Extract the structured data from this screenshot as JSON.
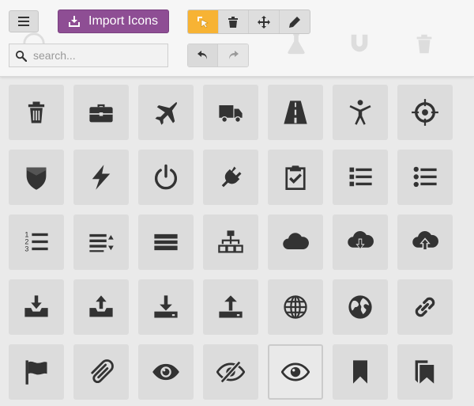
{
  "toolbar": {
    "menu_icon": "hamburger-icon",
    "import_button": {
      "label": "Import Icons",
      "icon": "import-icon"
    },
    "tools": [
      {
        "name": "select-tool",
        "icon": "select-cursor-icon",
        "active": true
      },
      {
        "name": "delete-tool",
        "icon": "trash-icon",
        "active": false
      },
      {
        "name": "move-tool",
        "icon": "move-arrows-icon",
        "active": false
      },
      {
        "name": "edit-tool",
        "icon": "pencil-icon",
        "active": false
      }
    ],
    "search": {
      "placeholder": "search...",
      "value": "",
      "icon": "search-icon"
    },
    "history": [
      {
        "name": "undo-button",
        "icon": "undo-icon"
      },
      {
        "name": "redo-button",
        "icon": "redo-icon"
      }
    ]
  },
  "colors": {
    "accent_purple": "#8e4e94",
    "active_tool": "#f7b334",
    "tile_bg": "#dcdcdc",
    "icon_fill": "#333333"
  },
  "icons": [
    {
      "name": "trash-icon"
    },
    {
      "name": "briefcase-icon"
    },
    {
      "name": "airplane-icon"
    },
    {
      "name": "truck-icon"
    },
    {
      "name": "road-icon"
    },
    {
      "name": "accessibility-icon"
    },
    {
      "name": "target-icon"
    },
    {
      "name": "shield-icon"
    },
    {
      "name": "lightning-icon"
    },
    {
      "name": "power-icon"
    },
    {
      "name": "plug-icon"
    },
    {
      "name": "clipboard-check-icon"
    },
    {
      "name": "list-icon"
    },
    {
      "name": "list-bullets-icon"
    },
    {
      "name": "list-numbered-icon"
    },
    {
      "name": "list-sort-icon"
    },
    {
      "name": "menu-bars-icon"
    },
    {
      "name": "sitemap-icon"
    },
    {
      "name": "cloud-icon"
    },
    {
      "name": "cloud-download-icon"
    },
    {
      "name": "cloud-upload-icon"
    },
    {
      "name": "tray-download-icon"
    },
    {
      "name": "tray-upload-icon"
    },
    {
      "name": "download-icon"
    },
    {
      "name": "upload-icon"
    },
    {
      "name": "globe-grid-icon"
    },
    {
      "name": "globe-earth-icon"
    },
    {
      "name": "link-icon"
    },
    {
      "name": "flag-icon"
    },
    {
      "name": "paperclip-icon"
    },
    {
      "name": "eye-icon"
    },
    {
      "name": "eye-blocked-icon"
    },
    {
      "name": "eye-outline-icon",
      "selected": true
    },
    {
      "name": "bookmark-icon"
    },
    {
      "name": "bookmarks-icon"
    }
  ]
}
